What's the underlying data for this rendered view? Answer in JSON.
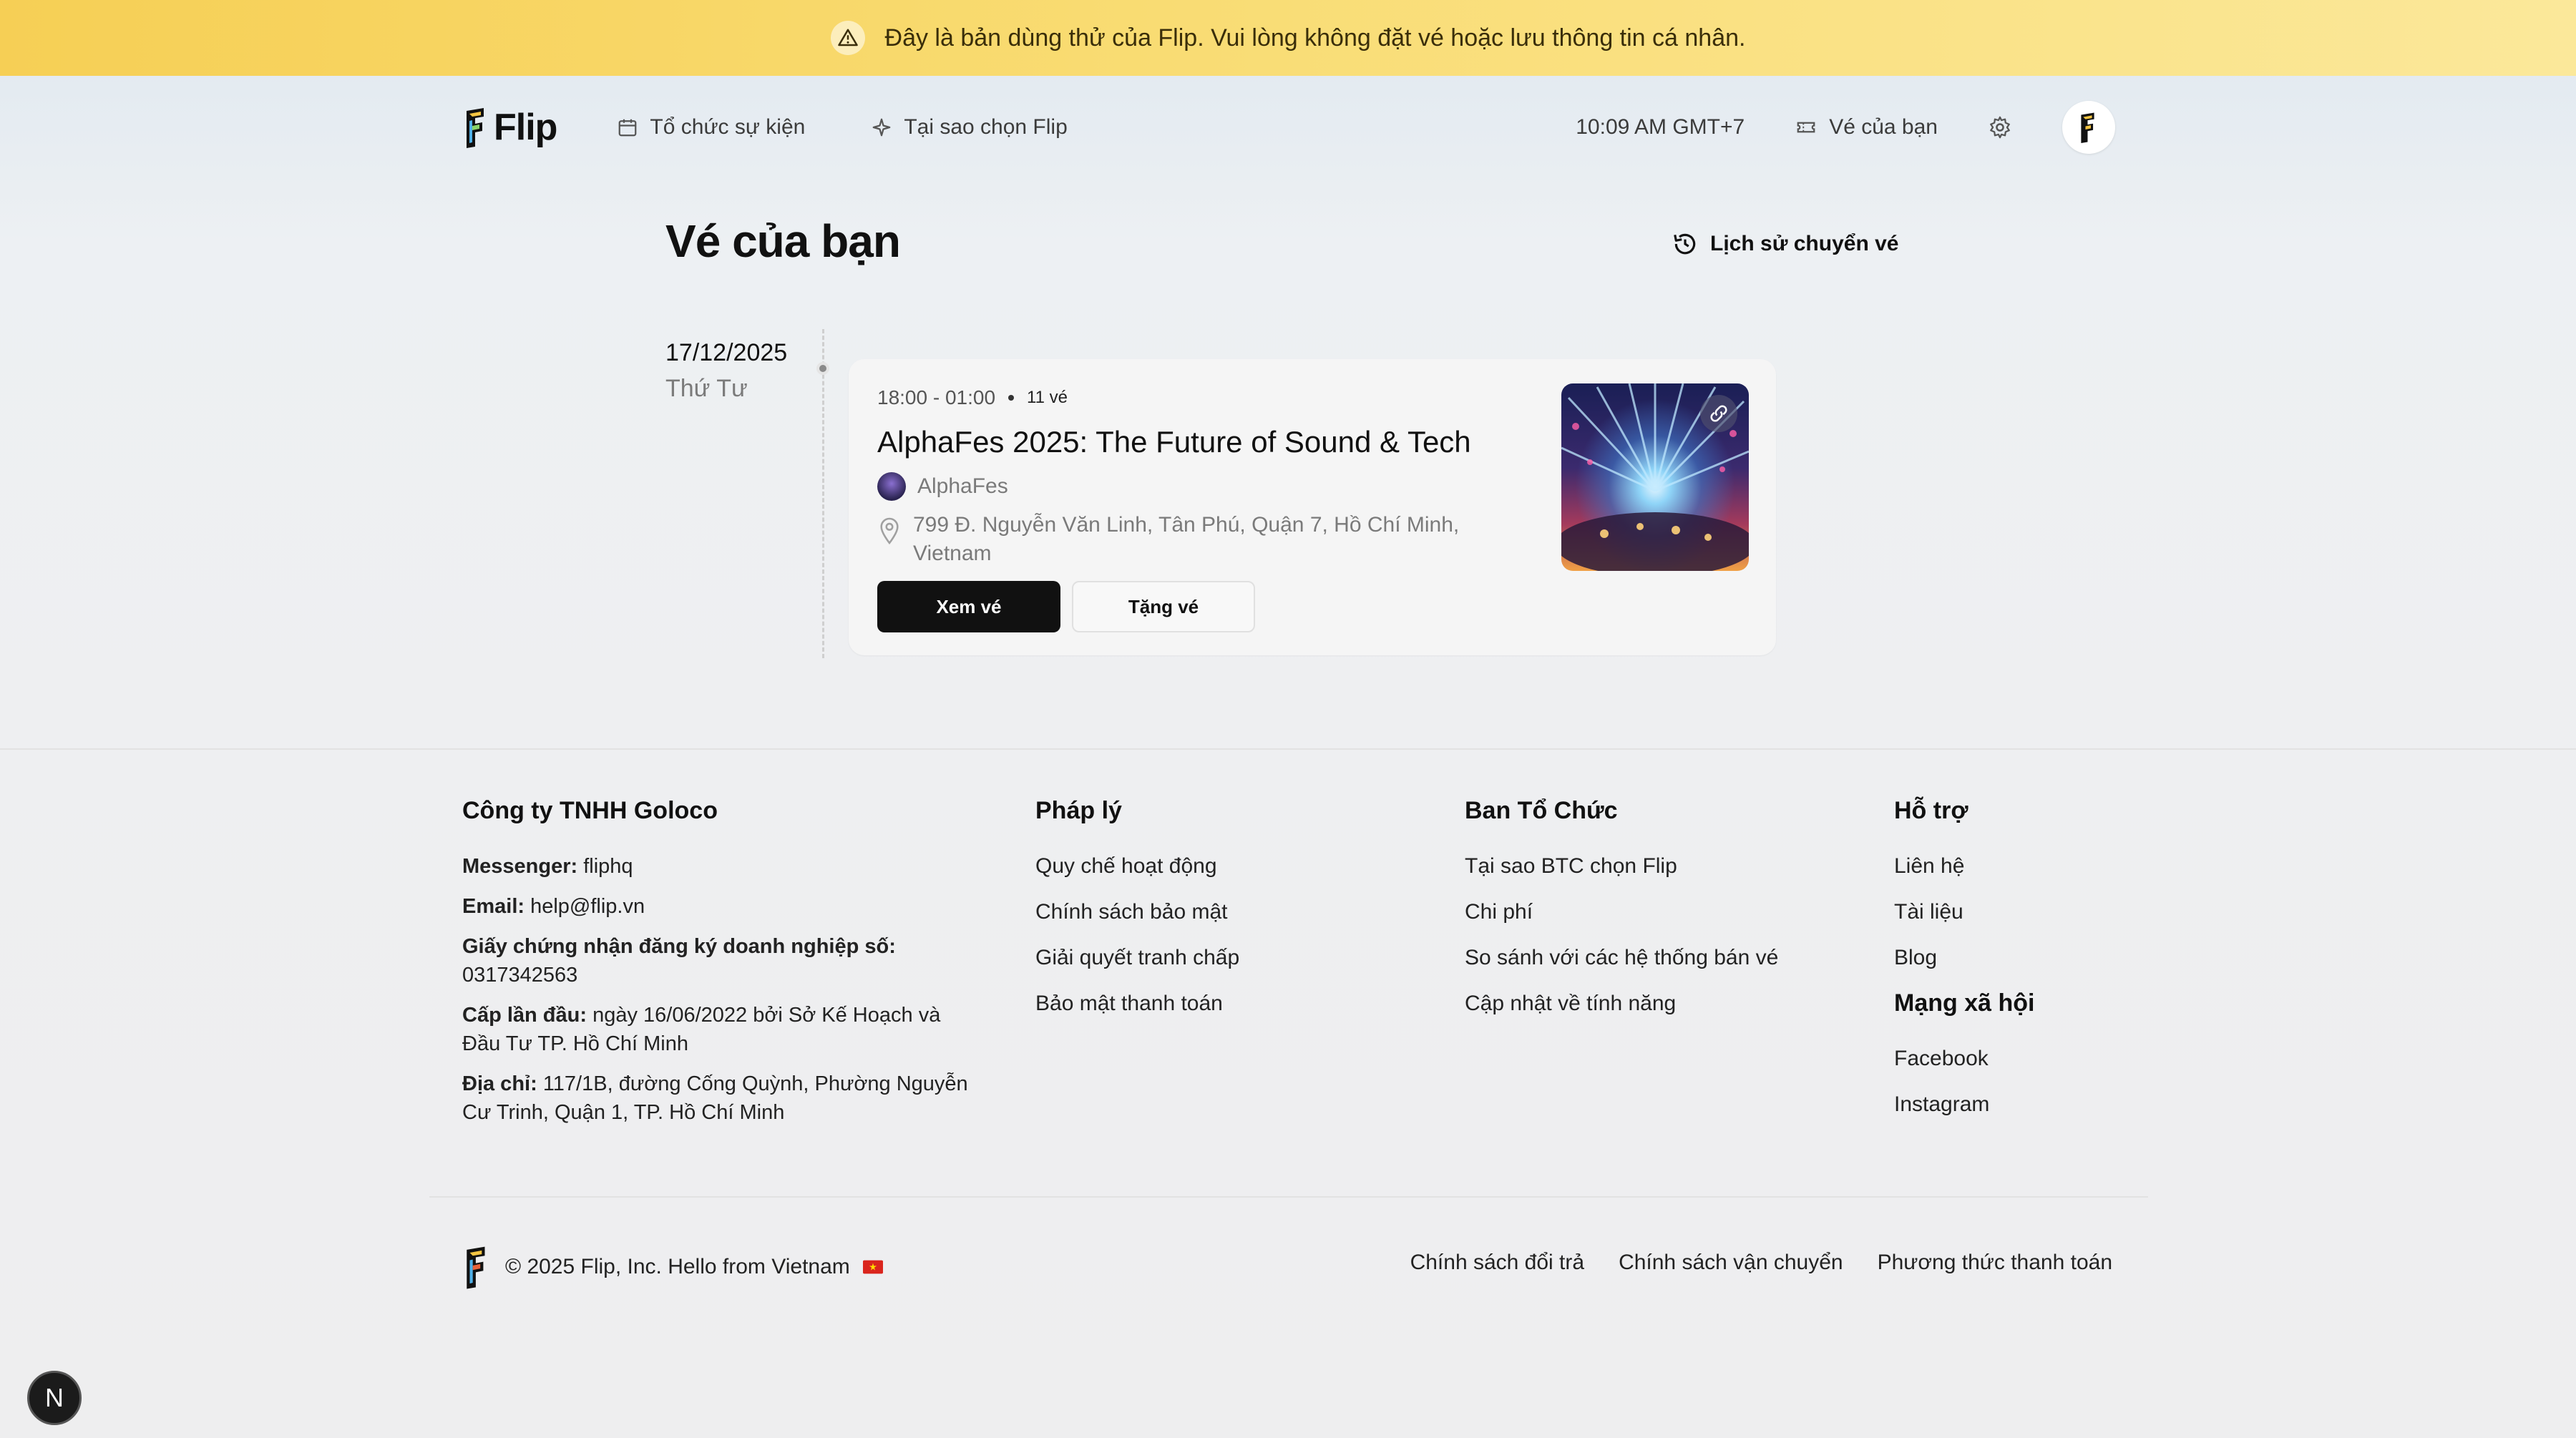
{
  "banner": {
    "icon": "warning-triangle-icon",
    "text": "Đây là bản dùng thử của Flip. Vui lòng không đặt vé hoặc lưu thông tin cá nhân."
  },
  "header": {
    "logo_text": "Flip",
    "nav_left": [
      {
        "label": "Tổ chức sự kiện",
        "icon": "calendar-plus-icon"
      },
      {
        "label": "Tại sao chọn Flip",
        "icon": "sparkle-icon"
      }
    ],
    "time": "10:09 AM GMT+7",
    "tickets_label": "Vé của bạn",
    "tickets_icon": "ticket-icon",
    "settings_icon": "gear-icon",
    "avatar_icon": "flip-avatar-icon"
  },
  "page": {
    "title": "Vé của bạn",
    "history_label": "Lịch sử chuyển vé",
    "history_icon": "history-icon"
  },
  "event_group": {
    "date": "17/12/2025",
    "weekday": "Thứ Tư"
  },
  "event": {
    "time_range": "18:00 - 01:00",
    "ticket_count": "11 vé",
    "title": "AlphaFes 2025: The Future of Sound & Tech",
    "organizer": "AlphaFes",
    "location": "799 Đ. Nguyễn Văn Linh, Tân Phú, Quận 7, Hồ Chí Minh, Vietnam",
    "view_button": "Xem vé",
    "gift_button": "Tặng vé"
  },
  "footer": {
    "company": {
      "heading": "Công ty TNHH Goloco",
      "messenger_label": "Messenger:",
      "messenger_value": "fliphq",
      "email_label": "Email:",
      "email_value": "help@flip.vn",
      "license_label": "Giấy chứng nhận đăng ký doanh nghiệp số:",
      "license_value": "0317342563",
      "issued_label": "Cấp lần đầu:",
      "issued_value": "ngày 16/06/2022 bởi Sở Kế Hoạch và Đầu Tư TP. Hồ Chí Minh",
      "address_label": "Địa chỉ:",
      "address_value": "117/1B, đường Cống Quỳnh, Phường Nguyễn Cư Trinh, Quận 1, TP. Hồ Chí Minh"
    },
    "legal": {
      "heading": "Pháp lý",
      "links": [
        "Quy chế hoạt động",
        "Chính sách bảo mật",
        "Giải quyết tranh chấp",
        "Bảo mật thanh toán"
      ]
    },
    "organizers": {
      "heading": "Ban Tổ Chức",
      "links": [
        "Tại sao BTC chọn Flip",
        "Chi phí",
        "So sánh với các hệ thống bán vé",
        "Cập nhật về tính năng"
      ]
    },
    "support": {
      "heading": "Hỗ trợ",
      "links": [
        "Liên hệ",
        "Tài liệu",
        "Blog"
      ]
    },
    "social": {
      "heading": "Mạng xã hội",
      "links": [
        "Facebook",
        "Instagram"
      ]
    },
    "copyright": "© 2025 Flip, Inc. Hello from Vietnam",
    "bottom_links": [
      "Chính sách đổi trả",
      "Chính sách vận chuyển",
      "Phương thức thanh toán"
    ]
  },
  "dev_badge": "N",
  "colors": {
    "banner": "#f8d86a",
    "primary_button": "#111111",
    "card_bg": "#f5f5f5"
  }
}
